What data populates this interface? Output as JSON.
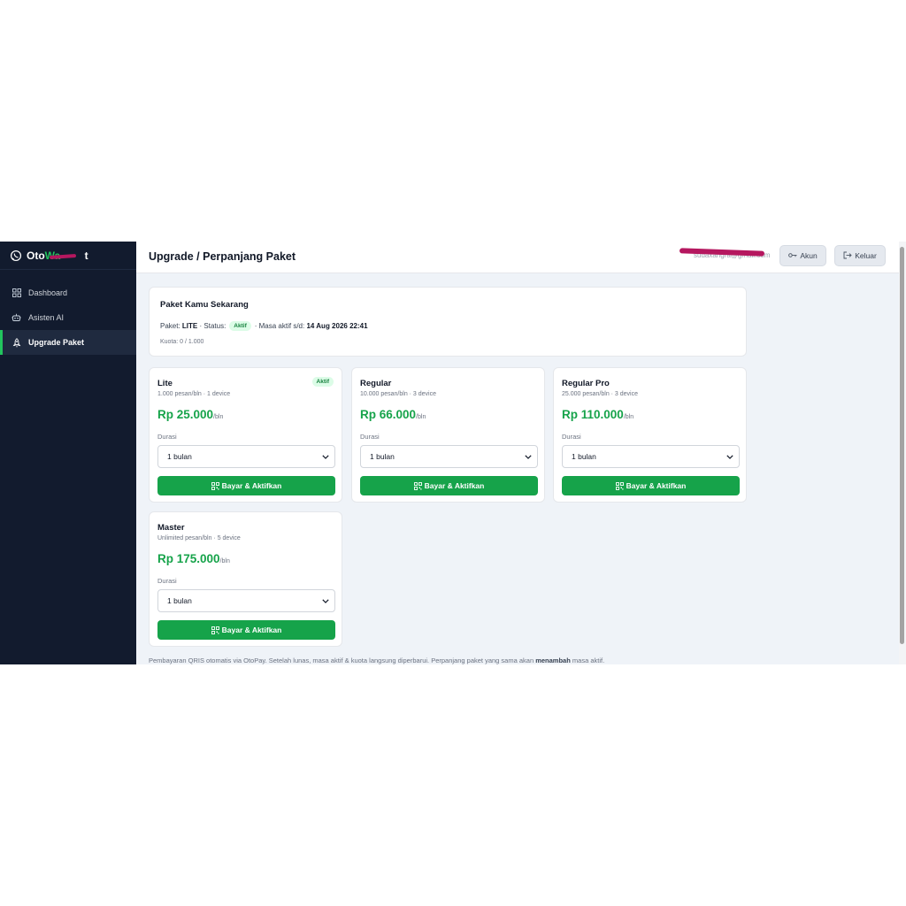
{
  "brand": {
    "prefix": "Oto",
    "accent": "Wa",
    "suffix": "t",
    "accent_color": "#22c55e"
  },
  "sidebar": {
    "items": [
      {
        "label": "Dashboard",
        "icon": "dashboard-grid-icon",
        "active": false
      },
      {
        "label": "Asisten AI",
        "icon": "robot-icon",
        "active": false
      },
      {
        "label": "Upgrade Paket",
        "icon": "rocket-icon",
        "active": true
      }
    ]
  },
  "header": {
    "title": "Upgrade / Perpanjang Paket",
    "email": "sudaxangra@gmail.com",
    "akun_label": "Akun",
    "keluar_label": "Keluar"
  },
  "current": {
    "title": "Paket Kamu Sekarang",
    "paket_prefix": "Paket:",
    "paket_value": "LITE",
    "status_prefix": "· Status:",
    "status_badge": "Aktif",
    "masa_prefix": "· Masa aktif s/d:",
    "masa_value": "14 Aug 2026 22:41",
    "quota": "Kuota: 0 / 1.000"
  },
  "plans": [
    {
      "name": "Lite",
      "desc": "1.000 pesan/bln · 1 device",
      "price": "Rp 25.000",
      "per": "/bln",
      "badge": "Aktif",
      "durasi_label": "Durasi",
      "durasi_value": "1 bulan",
      "button": "Bayar & Aktifkan"
    },
    {
      "name": "Regular",
      "desc": "10.000 pesan/bln · 3 device",
      "price": "Rp 66.000",
      "per": "/bln",
      "badge": "",
      "durasi_label": "Durasi",
      "durasi_value": "1 bulan",
      "button": "Bayar & Aktifkan"
    },
    {
      "name": "Regular Pro",
      "desc": "25.000 pesan/bln · 3 device",
      "price": "Rp 110.000",
      "per": "/bln",
      "badge": "",
      "durasi_label": "Durasi",
      "durasi_value": "1 bulan",
      "button": "Bayar & Aktifkan"
    },
    {
      "name": "Master",
      "desc": "Unlimited pesan/bln · 5 device",
      "price": "Rp 175.000",
      "per": "/bln",
      "badge": "",
      "durasi_label": "Durasi",
      "durasi_value": "1 bulan",
      "button": "Bayar & Aktifkan"
    }
  ],
  "footnote": {
    "text": "Pembayaran QRIS otomatis via OtoPay. Setelah lunas, masa aktif & kuota langsung diperbarui. Perpanjang paket yang sama akan",
    "bold": "menambah",
    "tail": "masa aktif."
  },
  "colors": {
    "sidebar_bg": "#121b2e",
    "primary_green": "#16a34a",
    "content_bg": "#eff3f8"
  }
}
